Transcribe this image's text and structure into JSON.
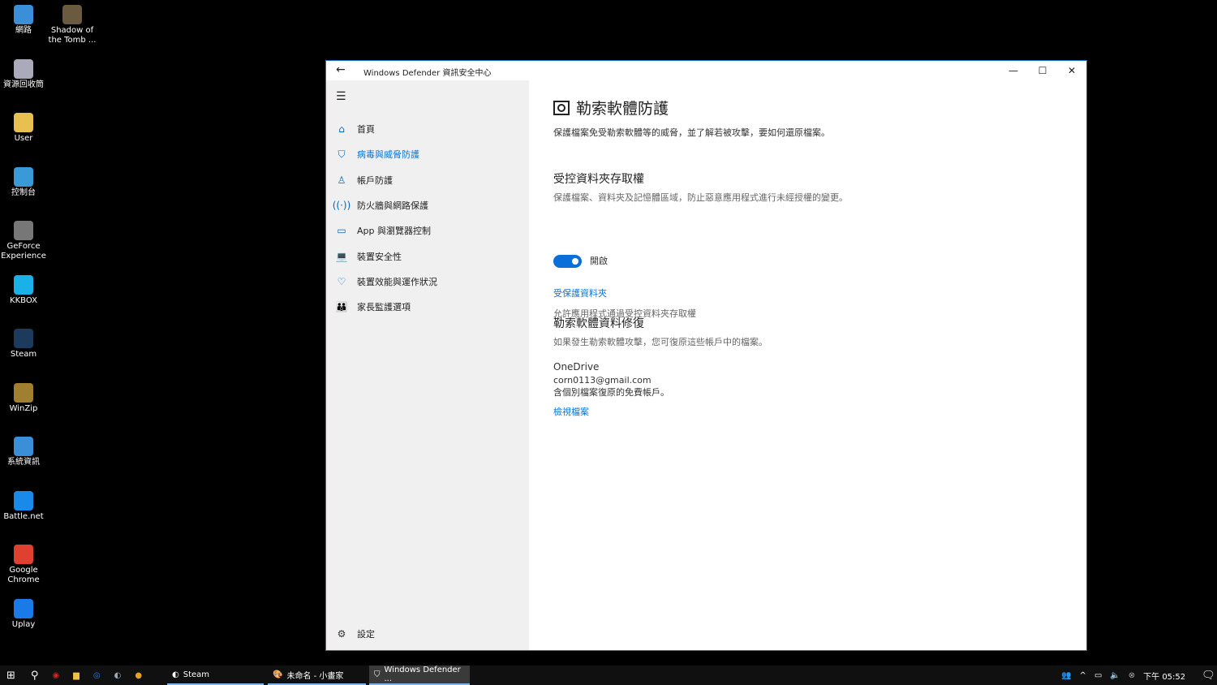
{
  "desktop": {
    "icons": [
      {
        "label": "網路",
        "color": "#3a8fd8"
      },
      {
        "label": "Shadow of the Tomb ...",
        "color": "#6a5a40"
      },
      {
        "label": "資源回收筒",
        "color": "#aab"
      },
      {
        "label": "User",
        "color": "#e8c050"
      },
      {
        "label": "控制台",
        "color": "#3a9ad8"
      },
      {
        "label": "GeForce Experience",
        "color": "#777"
      },
      {
        "label": "KKBOX",
        "color": "#1ab0e8"
      },
      {
        "label": "Steam",
        "color": "#1b3a5c"
      },
      {
        "label": "WinZip",
        "color": "#a08030"
      },
      {
        "label": "系統資訊",
        "color": "#3a8fd8"
      },
      {
        "label": "Battle.net",
        "color": "#1a8ae8"
      },
      {
        "label": "Google Chrome",
        "color": "#e04030"
      },
      {
        "label": "Uplay",
        "color": "#1a7ae8"
      }
    ]
  },
  "window": {
    "title": "Windows Defender 資訊安全中心",
    "back": "←",
    "minimize": "—",
    "maximize": "☐",
    "close": "✕"
  },
  "sidebar": {
    "menu": "☰",
    "items": [
      {
        "label": "首頁",
        "icon": "⌂",
        "name": "home"
      },
      {
        "label": "病毒與威脅防護",
        "icon": "⛉",
        "name": "virus-protection",
        "active": true
      },
      {
        "label": "帳戶防護",
        "icon": "♙",
        "name": "account"
      },
      {
        "label": "防火牆與網路保護",
        "icon": "((·))",
        "name": "firewall"
      },
      {
        "label": "App 與瀏覽器控制",
        "icon": "▭",
        "name": "app-browser"
      },
      {
        "label": "裝置安全性",
        "icon": "💻",
        "name": "device-security"
      },
      {
        "label": "裝置效能與運作狀況",
        "icon": "♡",
        "name": "device-health"
      },
      {
        "label": "家長監護選項",
        "icon": "👪",
        "name": "family"
      }
    ],
    "settings": "設定",
    "settings_icon": "⚙"
  },
  "main": {
    "title": "勒索軟體防護",
    "subtitle": "保護檔案免受勒索軟體等的威脅，並了解若被攻擊，要如何還原檔案。",
    "cfa_title": "受控資料夾存取權",
    "cfa_desc": "保護檔案、資料夾及記憶體區域，防止惡意應用程式進行未經授權的變更。",
    "toggle_on": true,
    "toggle_label": "開啟",
    "protected_link": "受保護資料夾",
    "allow_link": "允許應用程式通過受控資料夾存取權",
    "recovery_title": "勒索軟體資料修復",
    "recovery_desc": "如果發生勒索軟體攻擊，您可復原這些帳戶中的檔案。",
    "provider": "OneDrive",
    "email": "corn0113@gmail.com",
    "account_desc": "含個別檔案復原的免費帳戶。",
    "view_files": "檢視檔案"
  },
  "taskbar": {
    "tasks": [
      {
        "label": "Steam"
      },
      {
        "label": "未命名 - 小畫家"
      },
      {
        "label": "Windows Defender ..."
      }
    ],
    "clock": "下午 05:52"
  },
  "colors": {
    "accent": "#0a74d8",
    "sidebar": "#f0f0f0"
  }
}
